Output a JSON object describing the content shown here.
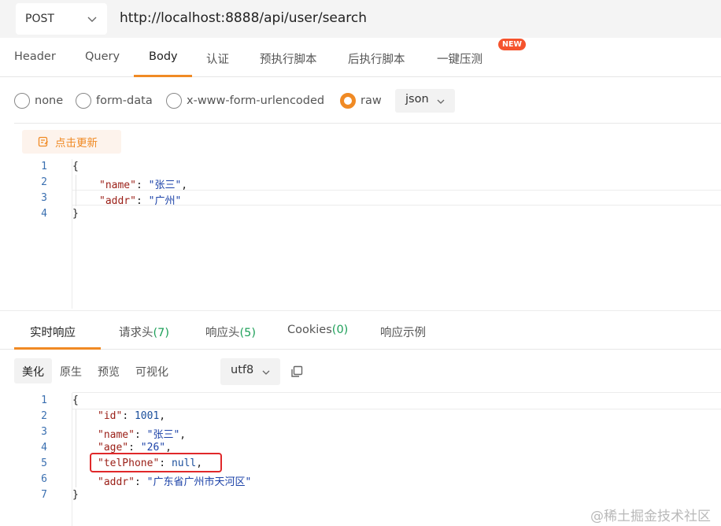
{
  "request": {
    "method": "POST",
    "url": "http://localhost:8888/api/user/search"
  },
  "request_tabs": [
    {
      "label": "Header"
    },
    {
      "label": "Query"
    },
    {
      "label": "Body"
    },
    {
      "label": "认证"
    },
    {
      "label": "预执行脚本"
    },
    {
      "label": "后执行脚本"
    },
    {
      "label": "一键压测"
    }
  ],
  "active_request_tab": "Body",
  "new_badge": "NEW",
  "body_types": [
    {
      "label": "none",
      "selected": false
    },
    {
      "label": "form-data",
      "selected": false
    },
    {
      "label": "x-www-form-urlencoded",
      "selected": false
    },
    {
      "label": "raw",
      "selected": true
    }
  ],
  "raw_format": "json",
  "update_button": "点击更新",
  "request_body_lines": [
    {
      "num": "1",
      "text": "{"
    },
    {
      "num": "2",
      "key": "\"name\"",
      "value": "\"张三\"",
      "suffix": ","
    },
    {
      "num": "3",
      "key": "\"addr\"",
      "value": "\"广州\"",
      "suffix": ""
    },
    {
      "num": "4",
      "text": "}"
    }
  ],
  "response_tabs": [
    {
      "label": "实时响应",
      "count": ""
    },
    {
      "label": "请求头",
      "count": "(7)"
    },
    {
      "label": "响应头",
      "count": "(5)"
    },
    {
      "label": "Cookies",
      "count": "(0)"
    },
    {
      "label": "响应示例",
      "count": ""
    }
  ],
  "active_response_tab": "实时响应",
  "view_modes": [
    {
      "label": "美化",
      "selected": true
    },
    {
      "label": "原生",
      "selected": false
    },
    {
      "label": "预览",
      "selected": false
    },
    {
      "label": "可视化",
      "selected": false
    }
  ],
  "encoding": "utf8",
  "response_body_lines": [
    {
      "num": "1",
      "text": "{"
    },
    {
      "num": "2",
      "key": "\"id\"",
      "value": "1001",
      "suffix": ","
    },
    {
      "num": "3",
      "key": "\"name\"",
      "value": "\"张三\"",
      "suffix": ","
    },
    {
      "num": "4",
      "key": "\"age\"",
      "value": "\"26\"",
      "suffix": ","
    },
    {
      "num": "5",
      "key": "\"telPhone\"",
      "value": "null",
      "suffix": ","
    },
    {
      "num": "6",
      "key": "\"addr\"",
      "value": "\"广东省广州市天河区\"",
      "suffix": ""
    },
    {
      "num": "7",
      "text": "}"
    }
  ],
  "watermark": "@稀土掘金技术社区",
  "colors": {
    "accent": "#f08a24",
    "count_green": "#1fa05a",
    "highlight_red": "#e0282a",
    "badge_red": "#f5532d"
  },
  "icons": [
    "chevron-down-icon",
    "document-edit-icon",
    "copy-icon"
  ]
}
